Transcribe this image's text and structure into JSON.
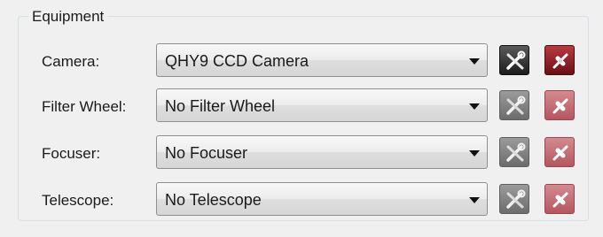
{
  "group": {
    "title": "Equipment"
  },
  "rows": [
    {
      "label": "Camera:",
      "value": "QHY9 CCD Camera",
      "buttons_enabled": true
    },
    {
      "label": "Filter Wheel:",
      "value": "No Filter Wheel",
      "buttons_enabled": false
    },
    {
      "label": "Focuser:",
      "value": "No Focuser",
      "buttons_enabled": false
    },
    {
      "label": "Telescope:",
      "value": "No Telescope",
      "buttons_enabled": false
    }
  ],
  "icons": {
    "settings": "tools-icon",
    "connect": "plug-connect-icon"
  },
  "colors": {
    "settings_enabled": "#2a2a2a",
    "connect_enabled": "#8b1a22",
    "settings_disabled": "#808080",
    "connect_disabled": "#c46a72"
  }
}
